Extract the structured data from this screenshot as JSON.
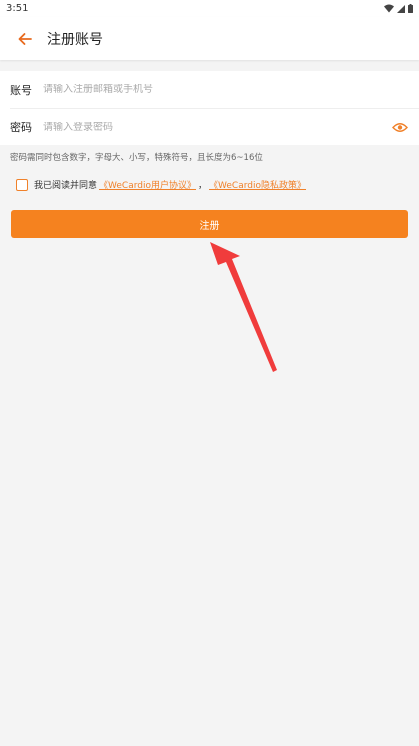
{
  "status_bar": {
    "time": "3:51"
  },
  "header": {
    "title": "注册账号"
  },
  "form": {
    "account_label": "账号",
    "account_placeholder": "请输入注册邮箱或手机号",
    "password_label": "密码",
    "password_placeholder": "请输入登录密码"
  },
  "hint": "密码需同时包含数字，字母大、小写，特殊符号，且长度为6~16位",
  "agreement": {
    "prefix": "我已阅读并同意",
    "user_agreement": "《WeCardio用户协议》",
    "separator": "，",
    "privacy_policy": "《WeCardio隐私政策》"
  },
  "register_button": "注册",
  "colors": {
    "accent": "#f5821f",
    "annotation_arrow": "#f03c3c"
  }
}
